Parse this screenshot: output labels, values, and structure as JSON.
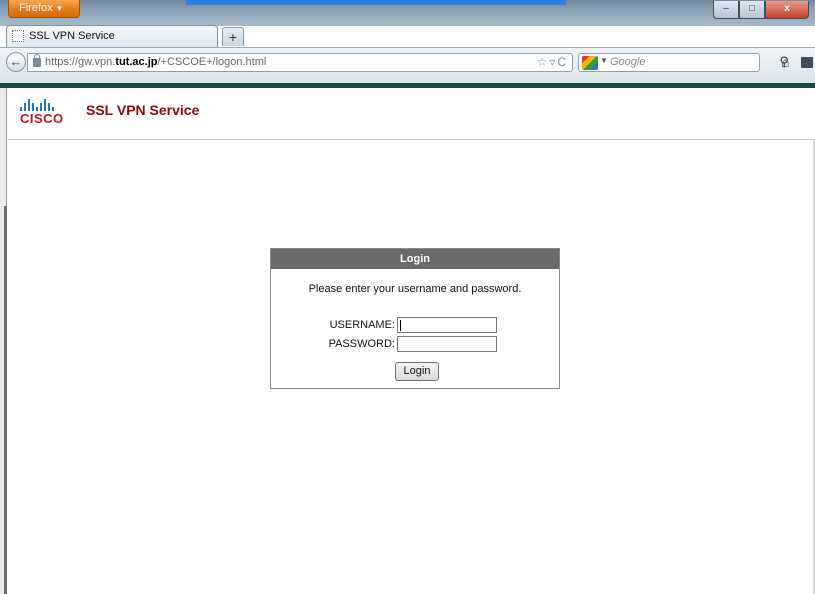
{
  "browser": {
    "app_button_label": "Firefox",
    "tab_title": "SSL VPN Service",
    "new_tab_symbol": "+",
    "url_prefix": "https://gw.vpn.",
    "url_domain": "tut.ac.jp",
    "url_path": "/+CSCOE+/logon.html",
    "search_placeholder": "Google",
    "icons": {
      "back": "back-arrow-icon",
      "lock": "lock-icon",
      "bookmark_star": "star-icon",
      "reload": "reload-icon",
      "search_engine": "google-icon",
      "search": "magnifier-icon",
      "home": "home-icon",
      "bookmarks": "bookmarks-icon"
    },
    "window_controls": {
      "minimize": "–",
      "maximize": "□",
      "close": "x"
    }
  },
  "page": {
    "brand_text": "CISCO",
    "service_title": "SSL VPN Service",
    "login": {
      "header": "Login",
      "instructions": "Please enter your username and password.",
      "username_label": "USERNAME:",
      "password_label": "PASSWORD:",
      "username_value": "",
      "password_value": "",
      "submit_label": "Login"
    }
  },
  "colors": {
    "firefox_orange": "#e37a18",
    "cisco_red": "#c01a1a",
    "cisco_blue": "#1a7bbf",
    "login_header_bg": "#6a6a6a"
  }
}
